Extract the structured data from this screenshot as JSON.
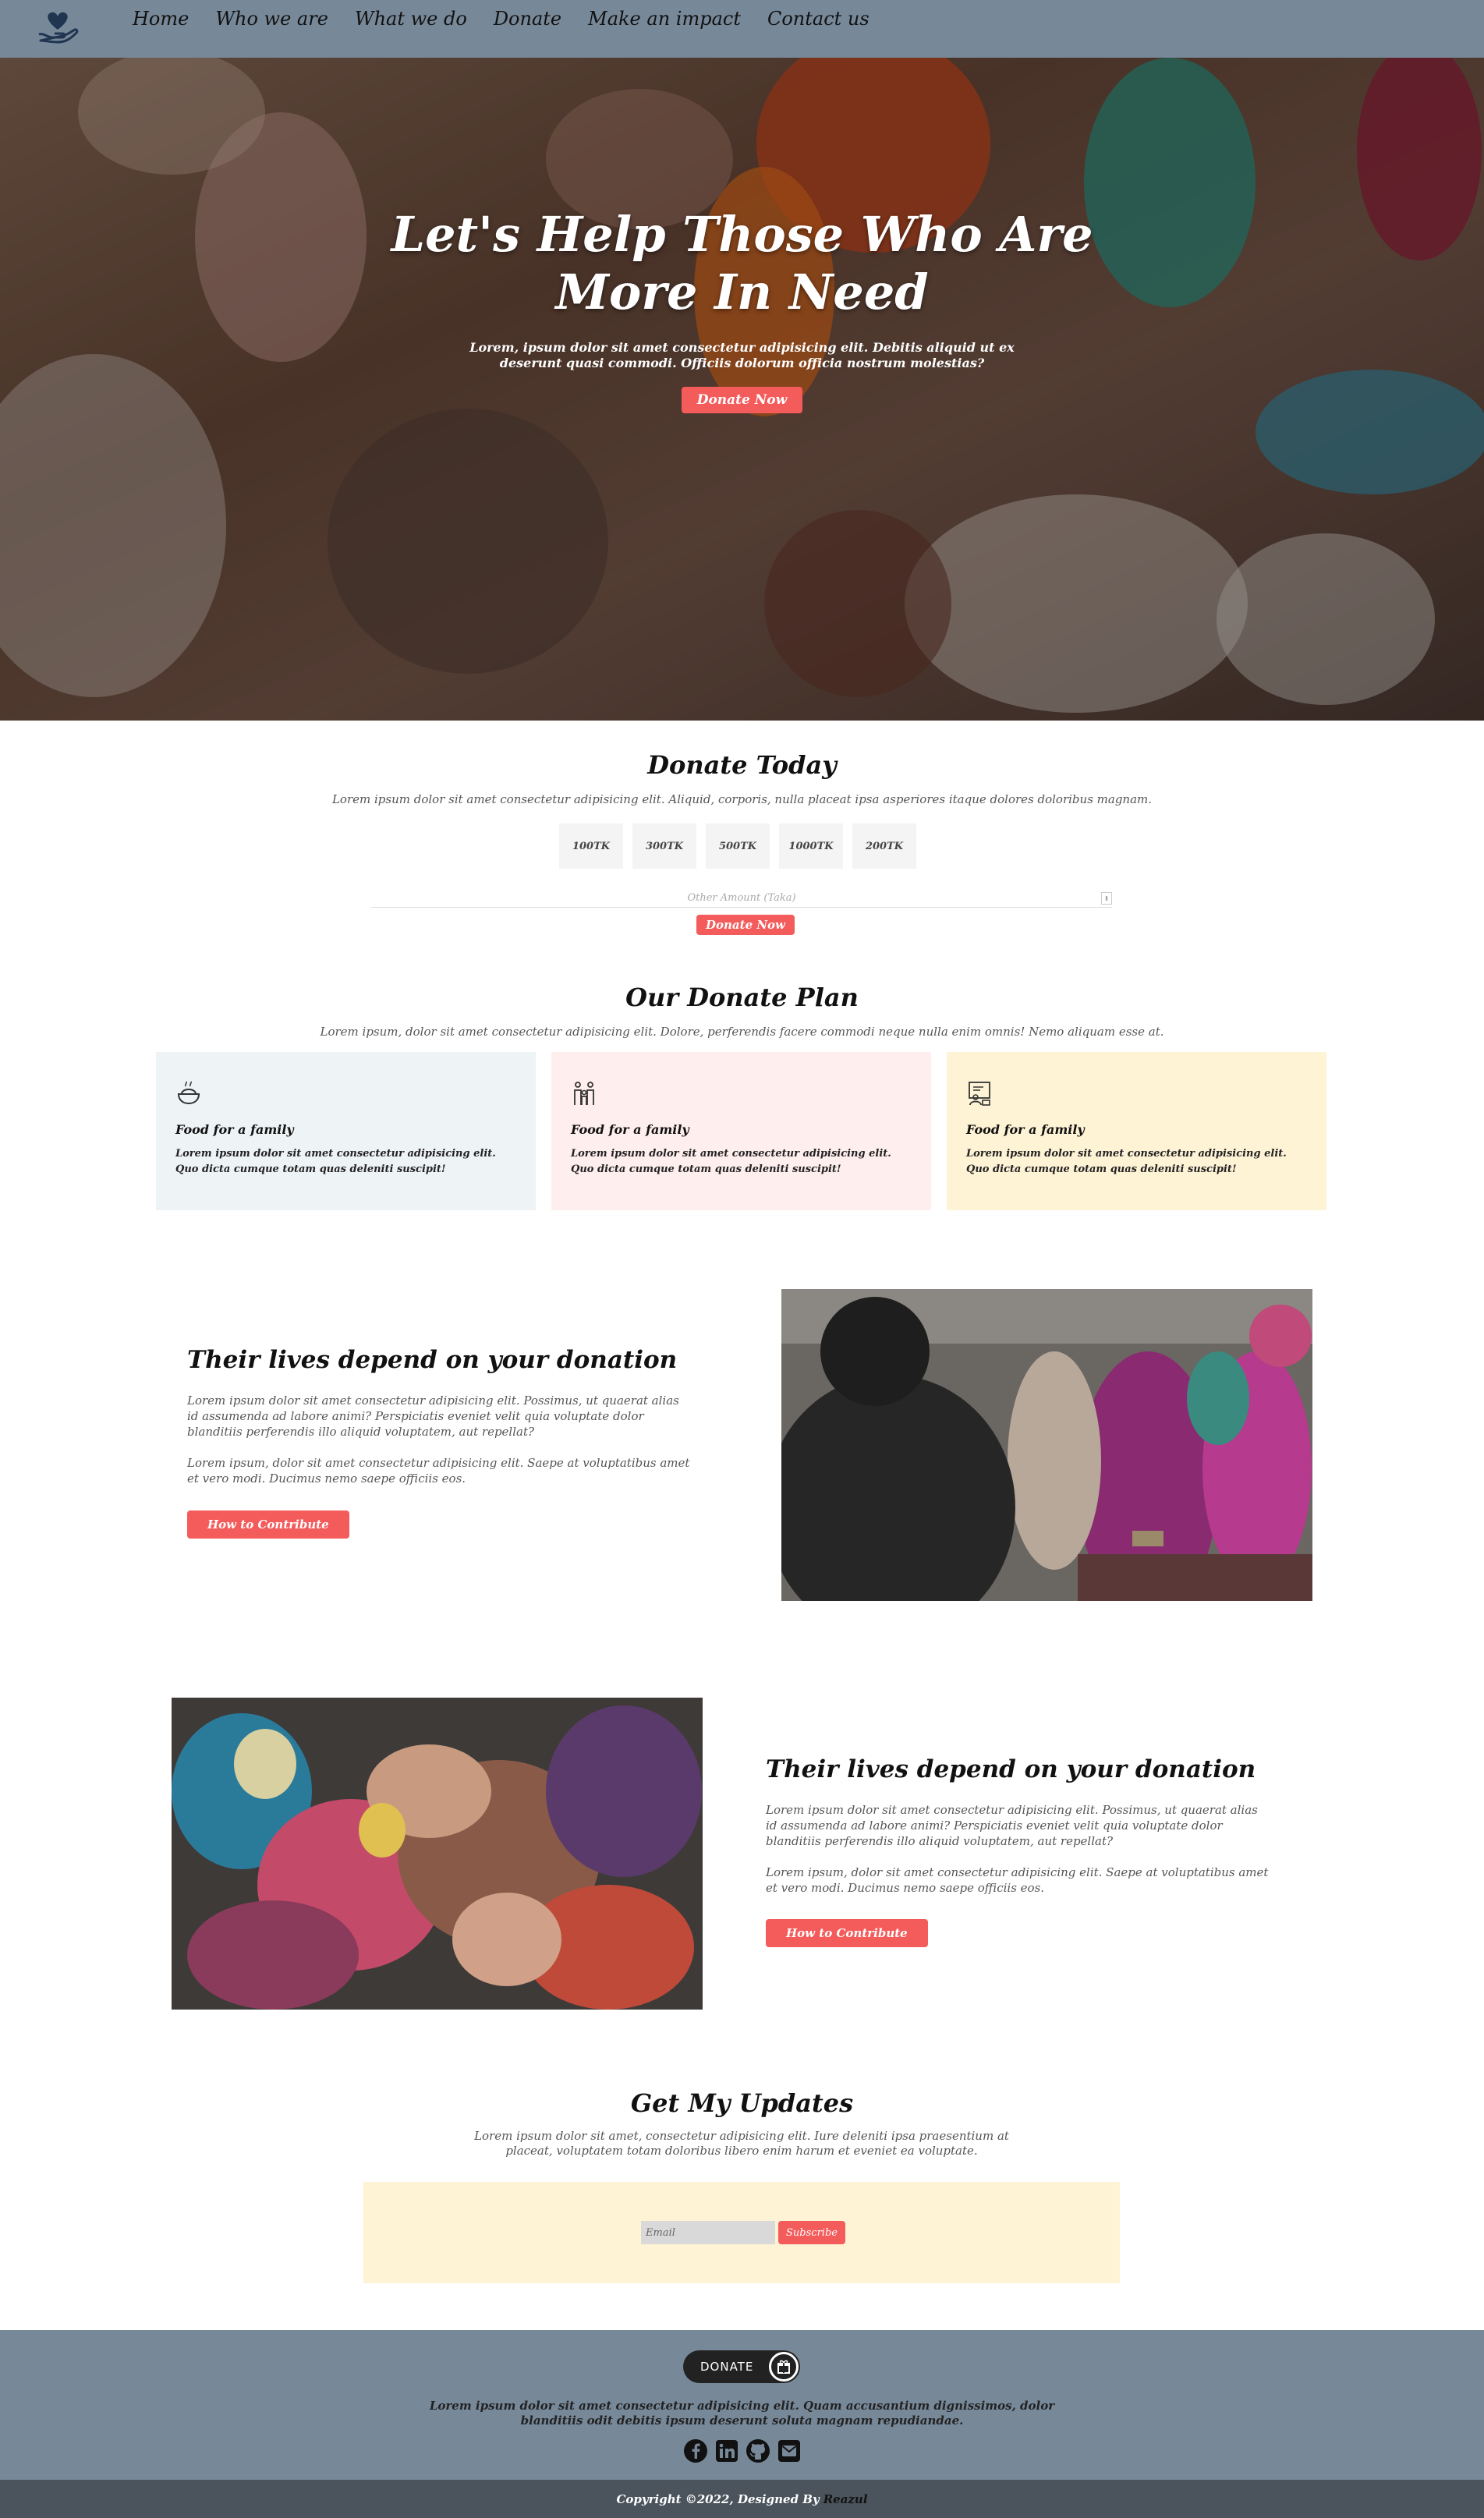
{
  "nav": {
    "logo_icon": "heart-hand-icon",
    "links": [
      "Home",
      "Who we are",
      "What we do",
      "Donate",
      "Make an impact",
      "Contact us"
    ]
  },
  "hero": {
    "title": "Let's Help Those Who Are More In Need",
    "subtitle": "Lorem, ipsum dolor sit amet consectetur adipisicing elit. Debitis aliquid ut ex deserunt quasi commodi. Officiis dolorum officia nostrum molestias?",
    "button": "Donate Now"
  },
  "donate_today": {
    "title": "Donate Today",
    "subtitle": "Lorem ipsum dolor sit amet consectetur adipisicing elit. Aliquid, corporis, nulla placeat ipsa asperiores itaque dolores doloribus magnam.",
    "amounts": [
      "100TK",
      "300TK",
      "500TK",
      "1000TK",
      "200TK"
    ],
    "other_placeholder": "Other Amount (Taka)",
    "button": "Donate Now"
  },
  "plan": {
    "title": "Our Donate Plan",
    "subtitle": "Lorem ipsum, dolor sit amet consectetur adipisicing elit. Dolore, perferendis facere commodi neque nulla enim omnis! Nemo aliquam esse at.",
    "cards": [
      {
        "icon": "food-bowl-icon",
        "title": "Food for a family",
        "text": "Lorem ipsum dolor sit amet consectetur adipisicing elit. Quo dicta cumque totam quas deleniti suscipit!",
        "bg": "#eef3f5"
      },
      {
        "icon": "family-icon",
        "title": "Food for a family",
        "text": "Lorem ipsum dolor sit amet consectetur adipisicing elit. Quo dicta cumque totam quas deleniti suscipit!",
        "bg": "#ffeeee"
      },
      {
        "icon": "teacher-board-icon",
        "title": "Food for a family",
        "text": "Lorem ipsum dolor sit amet consectetur adipisicing elit. Quo dicta cumque totam quas deleniti suscipit!",
        "bg": "#fff3d6"
      }
    ]
  },
  "feature1": {
    "title": "Their lives depend on your donation",
    "p1": "Lorem ipsum dolor sit amet consectetur adipisicing elit. Possimus, ut quaerat alias id assumenda ad labore animi? Perspiciatis eveniet velit quia voluptate dolor blanditiis perferendis illo aliquid voluptatem, aut repellat?",
    "p2": "Lorem ipsum, dolor sit amet consectetur adipisicing elit. Saepe at voluptatibus amet et vero modi. Ducimus nemo saepe officiis eos.",
    "button": "How to Contribute"
  },
  "feature2": {
    "title": "Their lives depend on your donation",
    "p1": "Lorem ipsum dolor sit amet consectetur adipisicing elit. Possimus, ut quaerat alias id assumenda ad labore animi? Perspiciatis eveniet velit quia voluptate dolor blanditiis perferendis illo aliquid voluptatem, aut repellat?",
    "p2": "Lorem ipsum, dolor sit amet consectetur adipisicing elit. Saepe at voluptatibus amet et vero modi. Ducimus nemo saepe officiis eos.",
    "button": "How to Contribute"
  },
  "updates": {
    "title": "Get My Updates",
    "subtitle": "Lorem ipsum dolor sit amet, consectetur adipisicing elit. Iure deleniti ipsa praesentium at placeat, voluptatem totam doloribus libero enim harum et eveniet ea voluptate.",
    "email_placeholder": "Email",
    "button": "Subscribe"
  },
  "footer": {
    "donate_label": "DONATE",
    "text": "Lorem ipsum dolor sit amet consectetur adipisicing elit. Quam accusantium dignissimos, dolor blanditiis odit debitis ipsum deserunt soluta magnam repudiandae.",
    "social": [
      "facebook-icon",
      "linkedin-icon",
      "github-icon",
      "email-icon"
    ],
    "copyright": "Copyright ©2022, Designed By",
    "author": "Reazul"
  },
  "colors": {
    "nav": "#778899",
    "accent": "#f45b5b",
    "copyright_bar": "#4b535c"
  }
}
